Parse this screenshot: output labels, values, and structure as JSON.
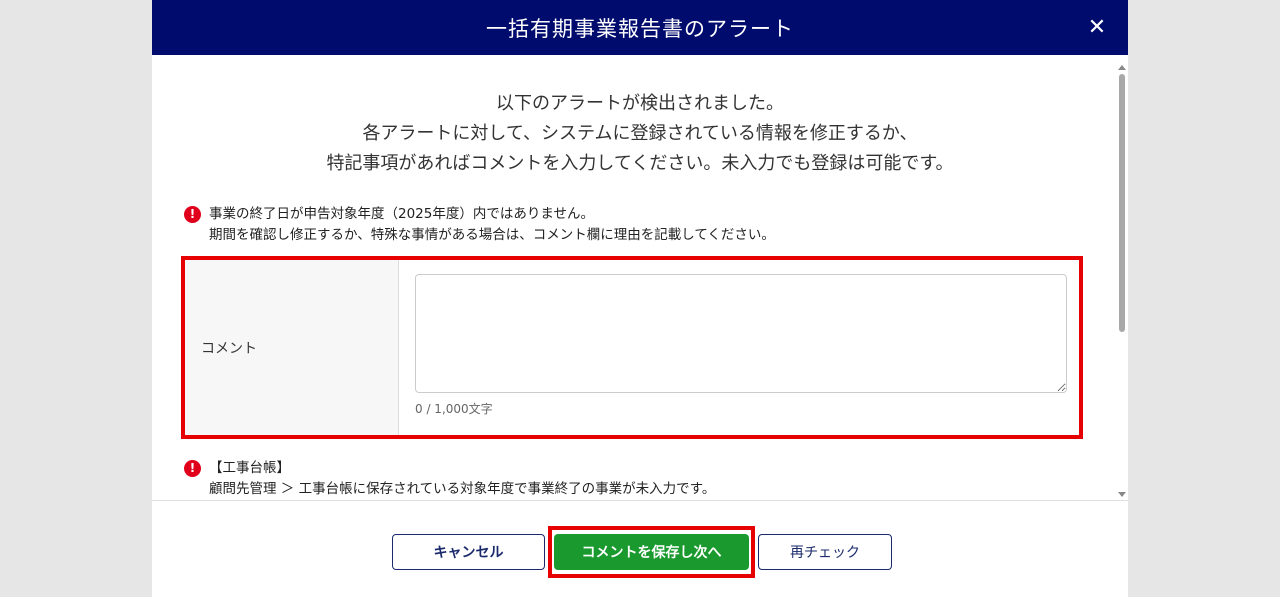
{
  "modal": {
    "title": "一括有期事業報告書のアラート",
    "close_symbol": "✕"
  },
  "intro": {
    "line1": "以下のアラートが検出されました。",
    "line2": "各アラートに対して、システムに登録されている情報を修正するか、",
    "line3": "特記事項があればコメントを入力してください。未入力でも登録は可能です。"
  },
  "alerts": [
    {
      "icon": "!",
      "line1": "事業の終了日が申告対象年度（2025年度）内ではありません。",
      "line2": "期間を確認し修正するか、特殊な事情がある場合は、コメント欄に理由を記載してください。"
    },
    {
      "icon": "!",
      "line1": "【工事台帳】",
      "line2": "顧問先管理 ＞ 工事台帳に保存されている対象年度で事業終了の事業が未入力です。"
    }
  ],
  "comment": {
    "label": "コメント",
    "value": "",
    "char_count": "0 / 1,000文字"
  },
  "footer": {
    "cancel_label": "キャンセル",
    "save_label": "コメントを保存し次へ",
    "recheck_label": "再チェック"
  },
  "colors": {
    "header_bg": "#000b6e",
    "highlight": "#e60000",
    "save_button": "#1a9a2e",
    "alert_icon": "#e0001b"
  }
}
